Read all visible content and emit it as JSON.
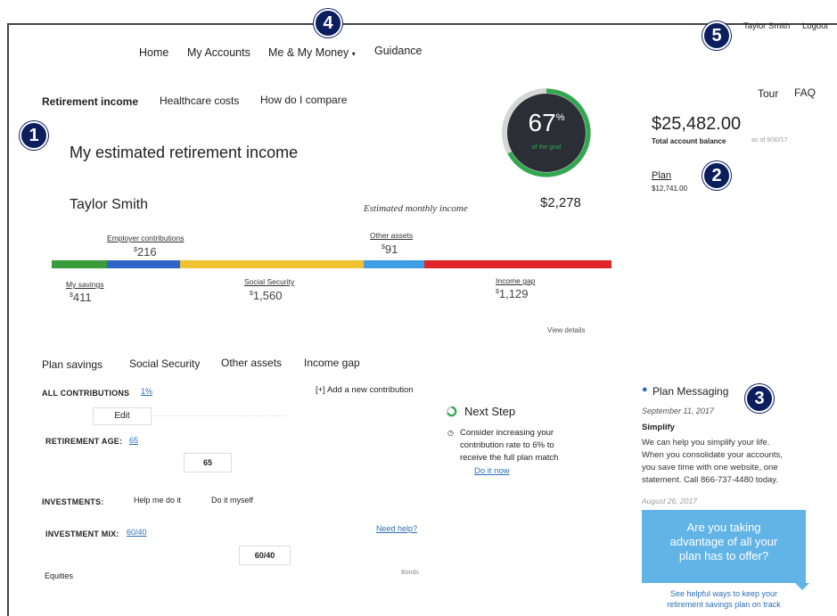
{
  "badges": [
    "1",
    "2",
    "3",
    "4",
    "5"
  ],
  "user": {
    "name": "Taylor Smith",
    "logout": "Logout"
  },
  "nav": {
    "home": "Home",
    "accounts": "My Accounts",
    "me_money": "Me & My Money",
    "guidance": "Guidance"
  },
  "subnav": {
    "retirement": "Retirement income",
    "healthcare": "Healthcare costs",
    "compare": "How do I compare"
  },
  "help": {
    "tour": "Tour",
    "faq": "FAQ"
  },
  "page": {
    "title": "My estimated retirement income",
    "person": "Taylor Smith",
    "monthly_label": "Estimated monthly income",
    "monthly_value": "$2,278"
  },
  "gauge": {
    "value": "67",
    "unit": "%",
    "subtitle": "of the goal",
    "percent": 67
  },
  "balance": {
    "value": "$25,482.00",
    "label": "Total account balance",
    "date": "as of 9/30/17"
  },
  "plan": {
    "label": "Plan",
    "value": "$12,741.00"
  },
  "income": {
    "employer": {
      "label": "Employer contributions",
      "amount": "216"
    },
    "other": {
      "label": "Other assets",
      "amount": "91"
    },
    "savings": {
      "label": "My savings",
      "amount": "411"
    },
    "social": {
      "label": "Social Security",
      "amount": "1,560"
    },
    "gap": {
      "label": "Income gap",
      "amount": "1,129"
    },
    "colors": {
      "savings": "#3a9b3a",
      "employer": "#2f64c8",
      "social": "#f1c232",
      "other": "#3d9ee6",
      "gap": "#e0262a"
    },
    "view_details": "View details"
  },
  "tabs": {
    "plan_savings": "Plan savings",
    "social": "Social Security",
    "other": "Other assets",
    "gap": "Income gap"
  },
  "contributions": {
    "heading": "ALL CONTRIBUTIONS",
    "value": "1%",
    "add": "[+] Add a new contribution",
    "edit": "Edit"
  },
  "retirement_age": {
    "heading": "RETIREMENT AGE:",
    "value": "65",
    "field": "65"
  },
  "investments": {
    "heading": "INVESTMENTS:",
    "help": "Help me do it",
    "self": "Do it myself"
  },
  "mix": {
    "heading": "INVESTMENT MIX:",
    "value": "60/40",
    "need_help": "Need help?",
    "field": "60/40",
    "equities": "Equities",
    "bonds": "Bonds"
  },
  "next_step": {
    "title": "Next Step",
    "text": [
      "Consider increasing your",
      "contribution rate to 6% to",
      "receive the full plan match"
    ],
    "action": "Do it now"
  },
  "messaging": {
    "title": "Plan Messaging",
    "date1": "September 11, 2017",
    "heading": "Simplify",
    "body": [
      "We can help you simplify your life.",
      "When you consolidate your accounts,",
      "you save time with one website, one",
      "statement. Call 866-737-4480 today."
    ],
    "date2": "August 26, 2017",
    "promo": [
      "Are you taking",
      "advantage of all your",
      "plan has to offer?"
    ],
    "promo_link": [
      "See helpful ways to keep your",
      "retirement savings plan on track"
    ]
  }
}
